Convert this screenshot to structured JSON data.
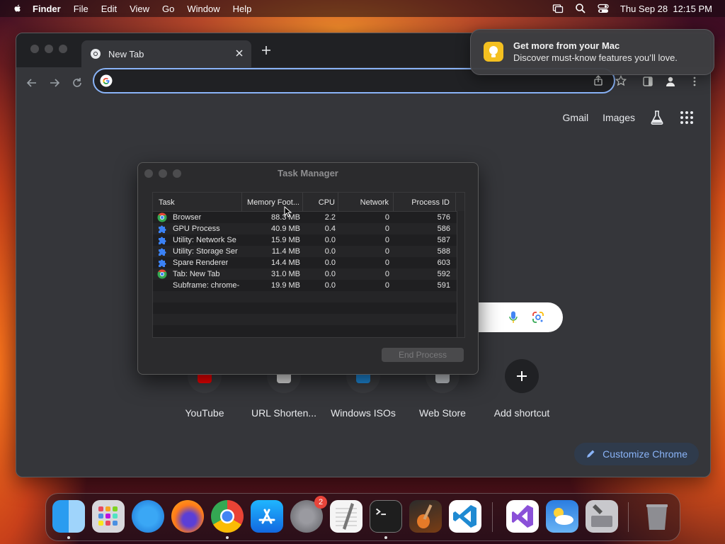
{
  "menubar": {
    "app": "Finder",
    "items": [
      "File",
      "Edit",
      "View",
      "Go",
      "Window",
      "Help"
    ],
    "clock": "Thu Sep 28  12:15 PM"
  },
  "browser": {
    "tab_title": "New Tab",
    "omnibox_value": "",
    "ntp": {
      "gmail": "Gmail",
      "images": "Images",
      "shortcuts": [
        "YouTube",
        "URL Shorten...",
        "Windows ISOs",
        "Web Store",
        "Add shortcut"
      ],
      "customize": "Customize Chrome"
    }
  },
  "task_manager": {
    "title": "Task Manager",
    "columns": [
      "Task",
      "Memory Foot...",
      "CPU",
      "Network",
      "Process ID"
    ],
    "rows": [
      {
        "task": "Browser",
        "memory": "88.3 MB",
        "cpu": "2.2",
        "network": "0",
        "pid": "576",
        "icon": "chrome-icon"
      },
      {
        "task": "GPU Process",
        "memory": "40.9 MB",
        "cpu": "0.4",
        "network": "0",
        "pid": "586",
        "icon": "puzzle-icon"
      },
      {
        "task": "Utility: Network Se",
        "memory": "15.9 MB",
        "cpu": "0.0",
        "network": "0",
        "pid": "587",
        "icon": "puzzle-icon"
      },
      {
        "task": "Utility: Storage Ser",
        "memory": "11.4 MB",
        "cpu": "0.0",
        "network": "0",
        "pid": "588",
        "icon": "puzzle-icon"
      },
      {
        "task": "Spare Renderer",
        "memory": "14.4 MB",
        "cpu": "0.0",
        "network": "0",
        "pid": "603",
        "icon": "puzzle-icon"
      },
      {
        "task": "Tab: New Tab",
        "memory": "31.0 MB",
        "cpu": "0.0",
        "network": "0",
        "pid": "592",
        "icon": "chrome-icon"
      },
      {
        "task": "Subframe: chrome-",
        "memory": "19.9 MB",
        "cpu": "0.0",
        "network": "0",
        "pid": "591",
        "icon": ""
      }
    ],
    "end_process": "End Process"
  },
  "notification": {
    "title": "Get more from your Mac",
    "body": "Discover must-know features you’ll love."
  },
  "dock": {
    "apps": [
      "Finder",
      "Launchpad",
      "Safari",
      "Firefox",
      "Google Chrome",
      "App Store",
      "System Settings",
      "TextEdit",
      "Terminal",
      "GarageBand",
      "Visual Studio Code",
      "Visual Studio",
      "Weather",
      "Utility",
      "Trash"
    ],
    "settings_badge": "2"
  },
  "colors": {
    "accent_blue": "#8ab4f8",
    "chrome_bg": "#35363a",
    "tab_strip": "#202124"
  }
}
